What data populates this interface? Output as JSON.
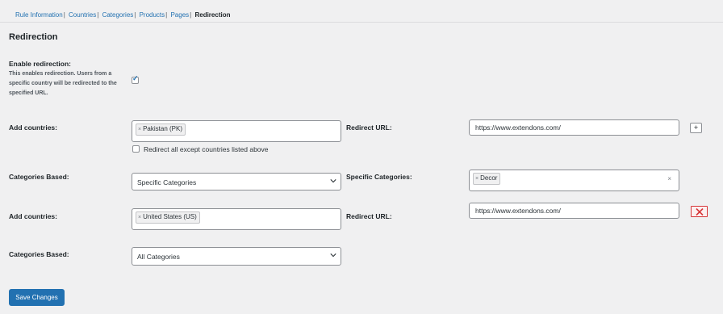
{
  "tabs": [
    {
      "label": "Rule Information",
      "sep": "|"
    },
    {
      "label": "Countries",
      "sep": "|"
    },
    {
      "label": "Categories",
      "sep": "|"
    },
    {
      "label": "Products",
      "sep": "|"
    },
    {
      "label": "Pages",
      "sep": "|"
    },
    {
      "label": "Redirection",
      "sep": ""
    }
  ],
  "section_title": "Redirection",
  "enable": {
    "label": "Enable redirection:",
    "description": "This enables redirection. Users from a specific country will be redirected to the specified URL.",
    "checked": true
  },
  "rule1": {
    "countries_label": "Add countries:",
    "country_tag": "Pakistan (PK)",
    "tag_remove": "×",
    "except_label": "Redirect all except countries listed above",
    "redirect_label": "Redirect URL:",
    "redirect_url": "https://www.extendons.com/",
    "add_button": "+",
    "categories_label": "Categories Based:",
    "categories_value": "Specific Categories",
    "specific_label": "Specific Categories:",
    "specific_tag": "Decor",
    "clear": "×"
  },
  "rule2": {
    "countries_label": "Add countries:",
    "country_tag": "United States (US)",
    "tag_remove": "×",
    "redirect_label": "Redirect URL:",
    "redirect_url": "https://www.extendons.com/",
    "categories_label": "Categories Based:",
    "categories_value": "All Categories"
  },
  "save_label": "Save Changes",
  "colors": {
    "accent": "#2271b1",
    "danger": "#d63638",
    "background": "#f0f0f1"
  }
}
